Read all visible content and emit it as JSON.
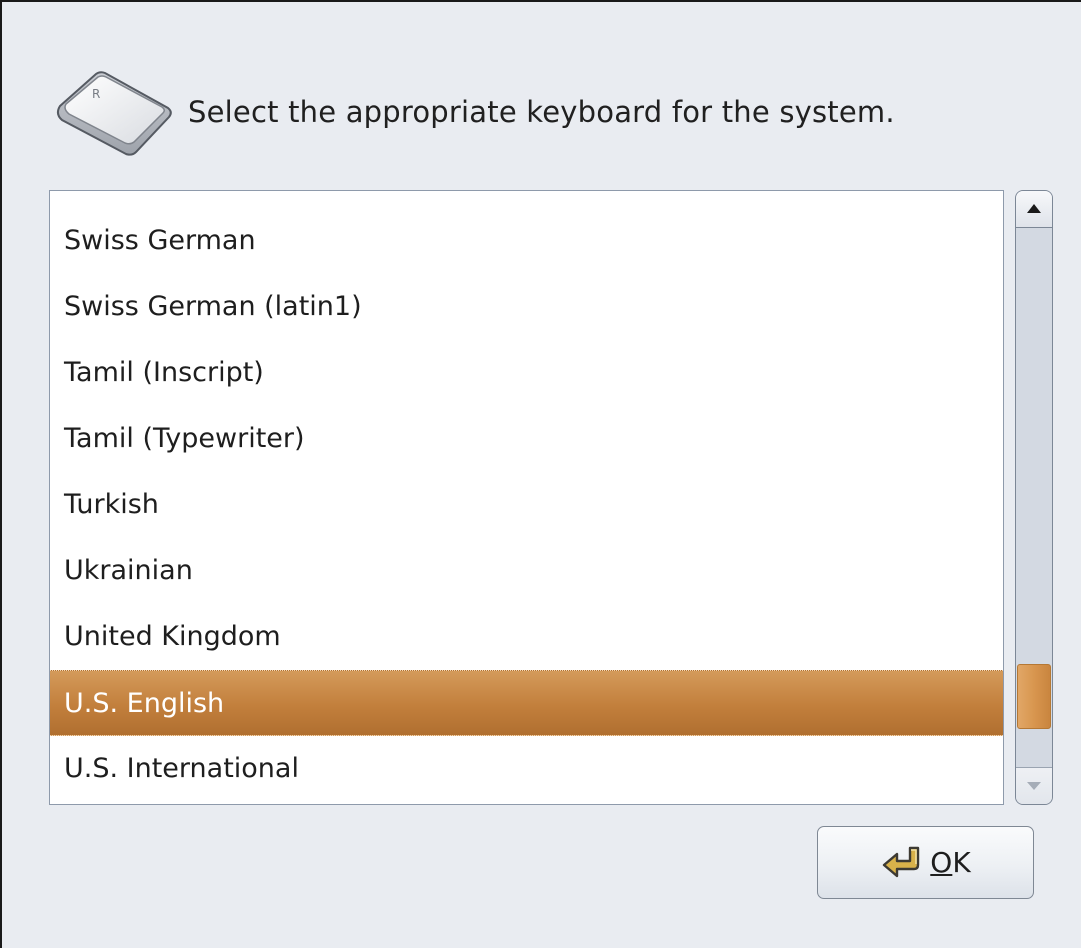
{
  "dialog": {
    "prompt": "Select the appropriate keyboard for the system.",
    "key_icon": "keyboard-key-icon",
    "key_cap_letter": "R"
  },
  "keyboard_list": {
    "items": [
      {
        "label": "Swiss German",
        "selected": false
      },
      {
        "label": "Swiss German (latin1)",
        "selected": false
      },
      {
        "label": "Tamil (Inscript)",
        "selected": false
      },
      {
        "label": "Tamil (Typewriter)",
        "selected": false
      },
      {
        "label": "Turkish",
        "selected": false
      },
      {
        "label": "Ukrainian",
        "selected": false
      },
      {
        "label": "United Kingdom",
        "selected": false
      },
      {
        "label": "U.S. English",
        "selected": true
      },
      {
        "label": "U.S. International",
        "selected": false
      }
    ],
    "selected_value": "U.S. English"
  },
  "scrollbar": {
    "up_icon": "arrow-up-icon",
    "down_icon": "arrow-down-icon",
    "scroll_position": 0.92,
    "visible_fraction": 0.12
  },
  "ok_button": {
    "mnemonic": "O",
    "rest": "K",
    "icon": "enter-return-icon"
  },
  "colors": {
    "selection": "#c8843f",
    "selection_text": "#ffffff",
    "dialog_background": "#e9ecf1",
    "scroll_thumb": "#d8964f"
  }
}
